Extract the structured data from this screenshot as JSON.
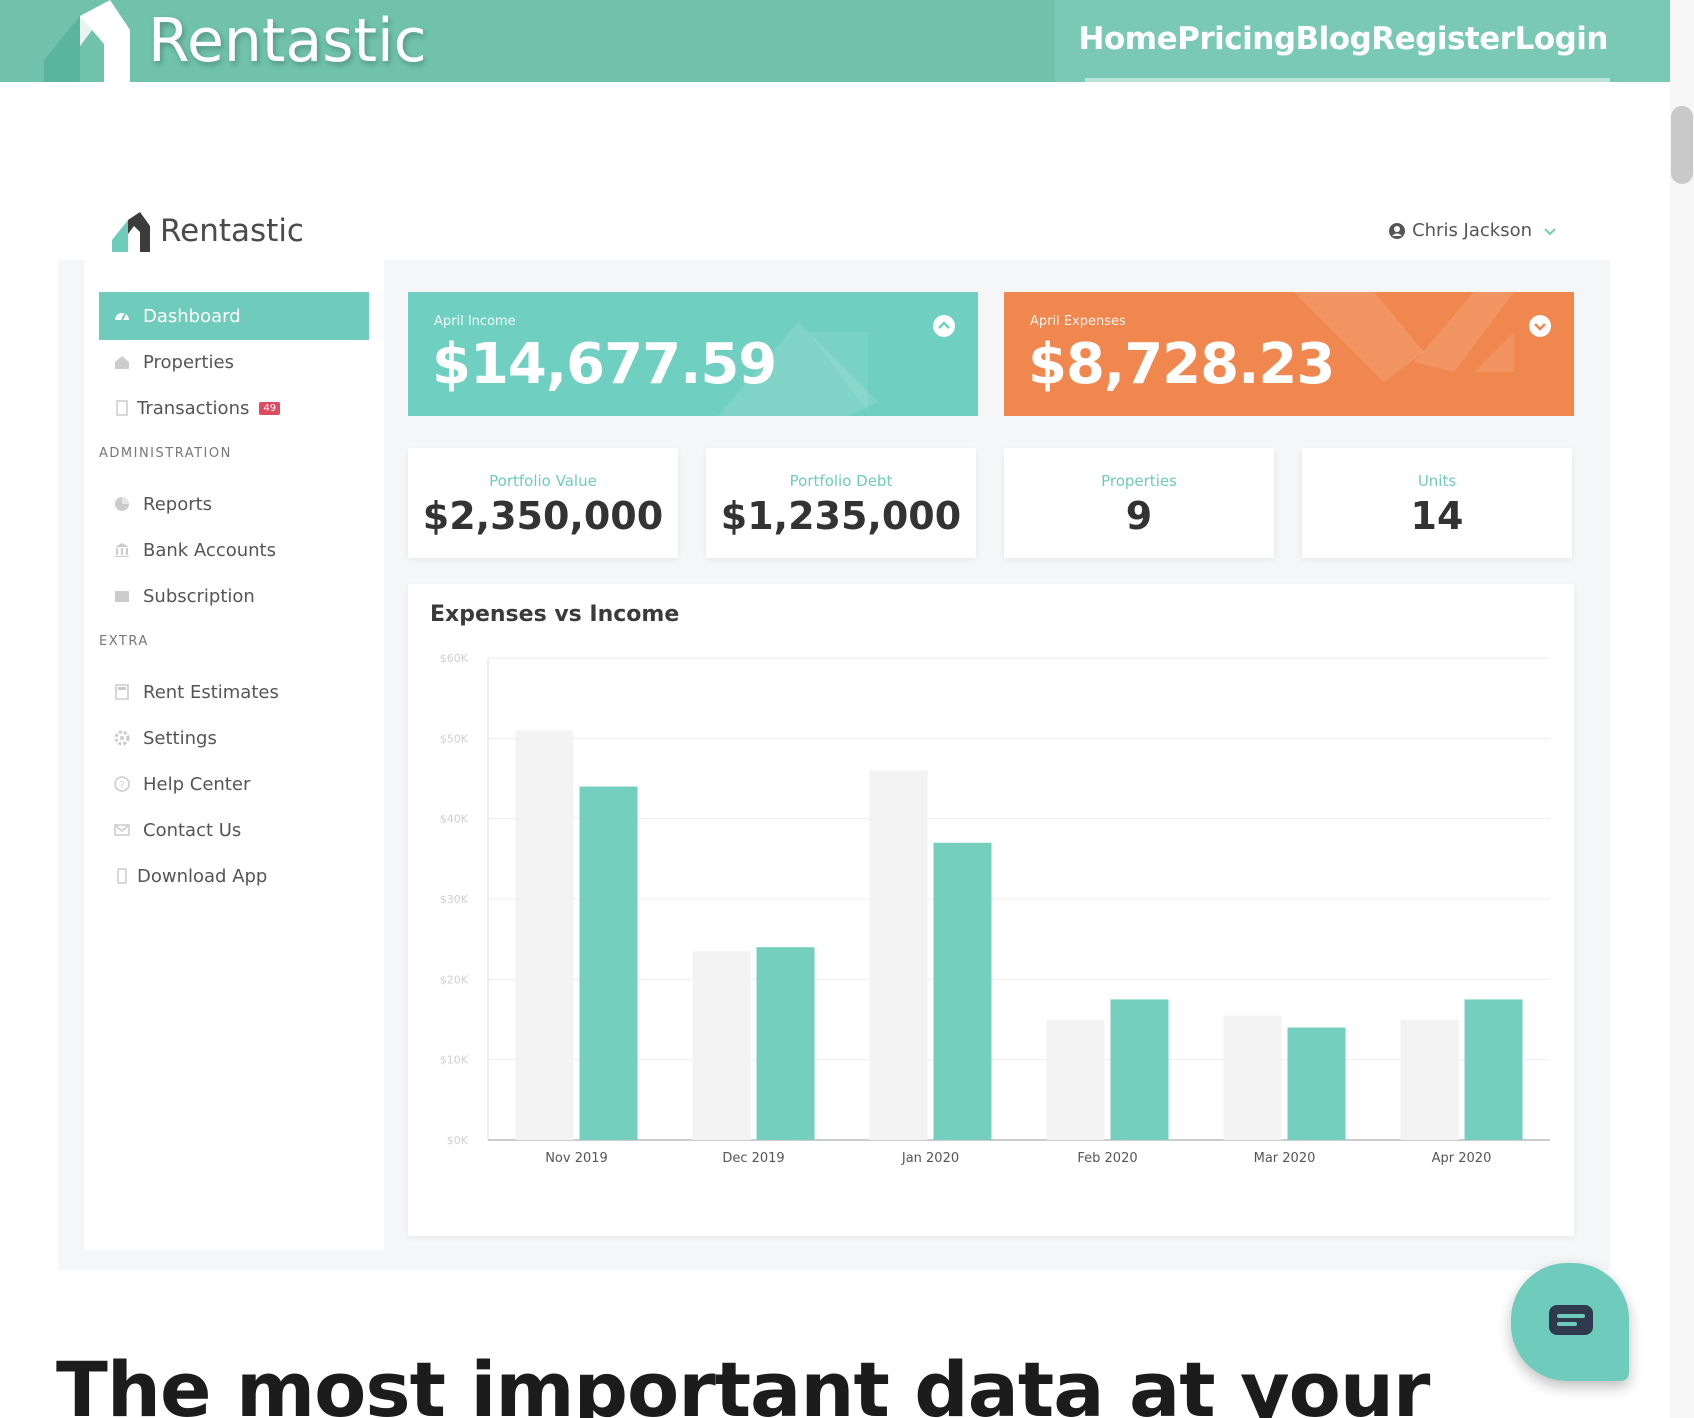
{
  "site": {
    "brand": "Rentastic",
    "nav": [
      "Home",
      "Pricing",
      "Blog",
      "Register",
      "Login"
    ]
  },
  "app": {
    "brand": "Rentastic",
    "user": "Chris Jackson",
    "sidebar": {
      "items": [
        {
          "label": "Dashboard",
          "icon": "dashboard-icon",
          "active": true
        },
        {
          "label": "Properties",
          "icon": "home-icon"
        },
        {
          "label": "Transactions",
          "icon": "document-icon",
          "badge": "49"
        }
      ],
      "sections": [
        {
          "title": "ADMINISTRATION",
          "items": [
            {
              "label": "Reports",
              "icon": "pie-chart-icon"
            },
            {
              "label": "Bank Accounts",
              "icon": "bank-icon"
            },
            {
              "label": "Subscription",
              "icon": "card-icon"
            }
          ]
        },
        {
          "title": "EXTRA",
          "items": [
            {
              "label": "Rent Estimates",
              "icon": "calculator-icon"
            },
            {
              "label": "Settings",
              "icon": "gear-icon"
            },
            {
              "label": "Help Center",
              "icon": "help-icon"
            },
            {
              "label": "Contact Us",
              "icon": "mail-icon"
            },
            {
              "label": "Download App",
              "icon": "phone-icon"
            }
          ]
        }
      ]
    },
    "income": {
      "label": "April Income",
      "value": "$14,677.59"
    },
    "expenses": {
      "label": "April Expenses",
      "value": "$8,728.23"
    },
    "stats": [
      {
        "label": "Portfolio Value",
        "value": "$2,350,000"
      },
      {
        "label": "Portfolio Debt",
        "value": "$1,235,000"
      },
      {
        "label": "Properties",
        "value": "9"
      },
      {
        "label": "Units",
        "value": "14"
      }
    ]
  },
  "chart_data": {
    "type": "bar",
    "title": "Expenses vs Income",
    "categories": [
      "Nov 2019",
      "Dec 2019",
      "Jan 2020",
      "Feb 2020",
      "Mar 2020",
      "Apr 2020"
    ],
    "series": [
      {
        "values": [
          51000,
          23500,
          46000,
          15000,
          15500,
          15000
        ],
        "color": "#f3f3f3"
      },
      {
        "values": [
          44000,
          24000,
          37000,
          17500,
          14000,
          17500
        ],
        "color": "#74cfbf"
      }
    ],
    "ylim": [
      0,
      60000
    ],
    "yticks": [
      "$0K",
      "$10K",
      "$20K",
      "$30K",
      "$40K",
      "$50K",
      "$60K"
    ],
    "grid": true
  },
  "headline": "The most important data at your"
}
